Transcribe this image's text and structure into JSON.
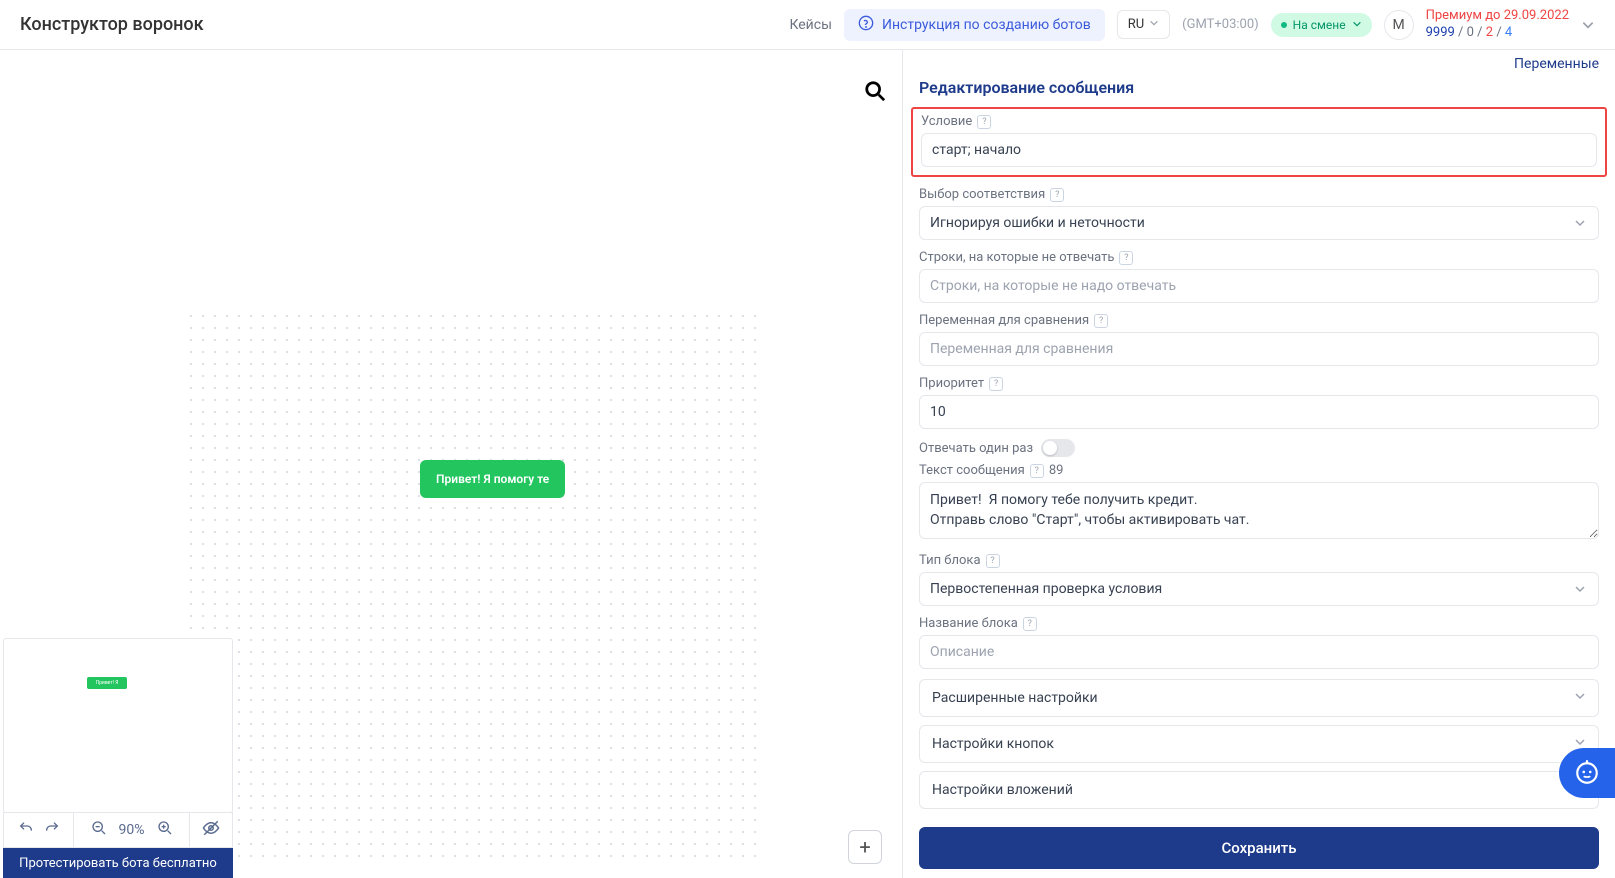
{
  "header": {
    "title": "Конструктор воронок",
    "cases_link": "Кейсы",
    "instruction": "Инструкция по созданию ботов",
    "lang": "RU",
    "timezone": "(GMT+03:00)",
    "status": "На смене",
    "avatar_letter": "М",
    "premium_line": "Премиум до 29.09.2022",
    "stats": {
      "a": "9999",
      "b": "0",
      "c": "2",
      "d": "4",
      "sep": " / "
    }
  },
  "canvas": {
    "node_text": "Привет!  Я помогу те",
    "minimap_node": "Привет! Я помогу те"
  },
  "toolbar": {
    "zoom": "90%",
    "test_btn": "Протестировать бота бесплатно"
  },
  "panel": {
    "variables_link": "Переменные",
    "title": "Редактирование сообщения",
    "condition": {
      "label": "Условие",
      "value": "старт; начало"
    },
    "match": {
      "label": "Выбор соответствия",
      "value": "Игнорируя ошибки и неточности"
    },
    "noreply": {
      "label": "Строки, на которые не отвечать",
      "placeholder": "Строки, на которые не надо отвечать"
    },
    "compare_var": {
      "label": "Переменная для сравнения",
      "placeholder": "Переменная для сравнения"
    },
    "priority": {
      "label": "Приоритет",
      "value": "10"
    },
    "reply_once": {
      "label": "Отвечать один раз"
    },
    "message": {
      "label": "Текст сообщения",
      "count": "89",
      "value": "Привет!  Я помогу тебе получить кредит.\nОтправь слово \"Старт\", чтобы активировать чат."
    },
    "block_type": {
      "label": "Тип блока",
      "value": "Первостепенная проверка условия"
    },
    "block_name": {
      "label": "Название блока",
      "placeholder": "Описание"
    },
    "accordion1": "Расширенные настройки",
    "accordion2": "Настройки кнопок",
    "accordion3": "Настройки вложений",
    "save": "Сохранить"
  }
}
